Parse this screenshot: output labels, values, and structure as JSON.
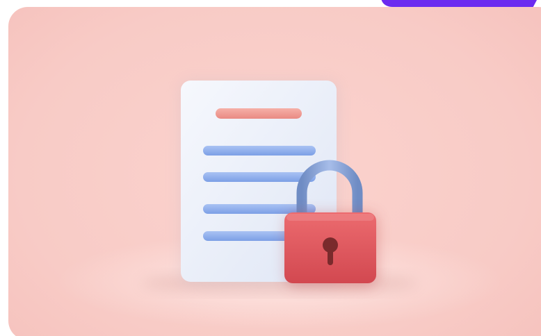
{
  "scene": {
    "description_icon": "locked-document-icon",
    "colors": {
      "background": "#f8cbc6",
      "document": "#eef2fb",
      "title_line": "#ee9a93",
      "text_lines": "#8fb0ee",
      "lock_body": "#e0555c",
      "lock_shackle": "#7f9ccf",
      "keyhole": "#7a2a2c",
      "corner_accent": "#6b2bf0"
    }
  }
}
